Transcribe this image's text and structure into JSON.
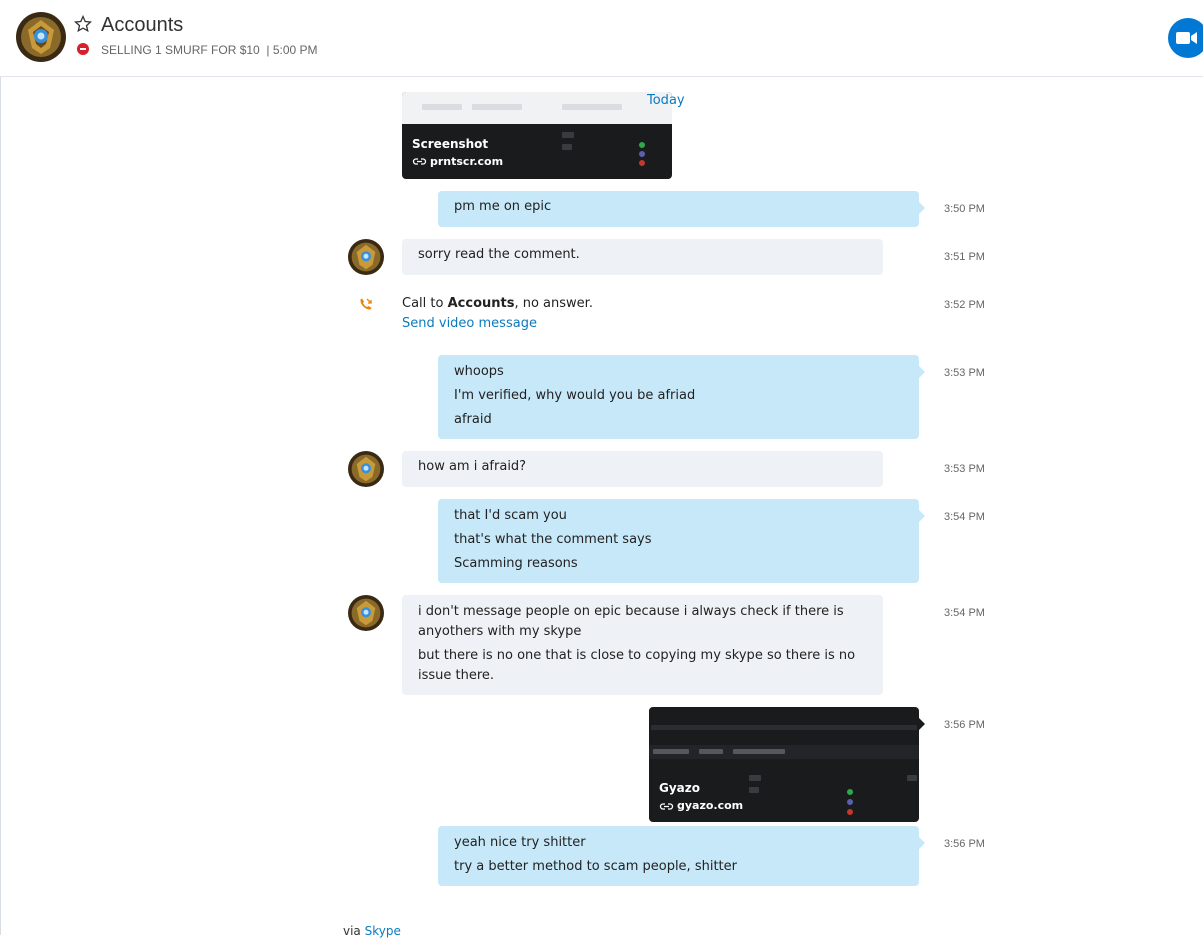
{
  "header": {
    "title": "Accounts",
    "mood": "SELLING 1 SMURF FOR $10",
    "mood_time": "5:00 PM",
    "separator": "|"
  },
  "conversation": {
    "date_divider": "Today",
    "preview1": {
      "title": "Screenshot",
      "host": "prntscr.com"
    },
    "msg1": {
      "lines": [
        "pm me on epic"
      ],
      "time": "3:50 PM"
    },
    "msg2": {
      "lines": [
        "sorry read the comment."
      ],
      "time": "3:51 PM"
    },
    "call": {
      "prefix": "Call to ",
      "name": "Accounts",
      "suffix": ", no answer.",
      "action": "Send video message",
      "time": "3:52 PM"
    },
    "msg3": {
      "lines": [
        "whoops",
        "I'm verified, why would you be afriad",
        "afraid"
      ],
      "time": "3:53 PM"
    },
    "msg4": {
      "lines": [
        "how am i afraid?"
      ],
      "time": "3:53 PM"
    },
    "msg5": {
      "lines": [
        "that I'd scam you",
        "that's what the comment says",
        "Scamming reasons"
      ],
      "time": "3:54 PM"
    },
    "msg6": {
      "lines": [
        "i don't message people on epic because i always check if there is anyothers with my skype",
        "but there is no one that is close to copying my skype so there is no issue there."
      ],
      "time": "3:54 PM"
    },
    "preview2": {
      "title": "Gyazo",
      "host": "gyazo.com",
      "time": "3:56 PM"
    },
    "msg7": {
      "lines": [
        "yeah nice try shitter",
        "try a better method to scam people, shitter"
      ],
      "time": "3:56 PM"
    }
  },
  "footer": {
    "via": "via ",
    "link": "Skype"
  },
  "colors": {
    "outgoing_bubble": "#c7e8f8",
    "incoming_bubble": "#eef1f6",
    "accent": "#0078d4",
    "dnd": "#d6202b"
  },
  "icons": [
    "star-icon",
    "do-not-disturb-icon",
    "video-call-icon",
    "link-icon",
    "missed-call-icon"
  ]
}
